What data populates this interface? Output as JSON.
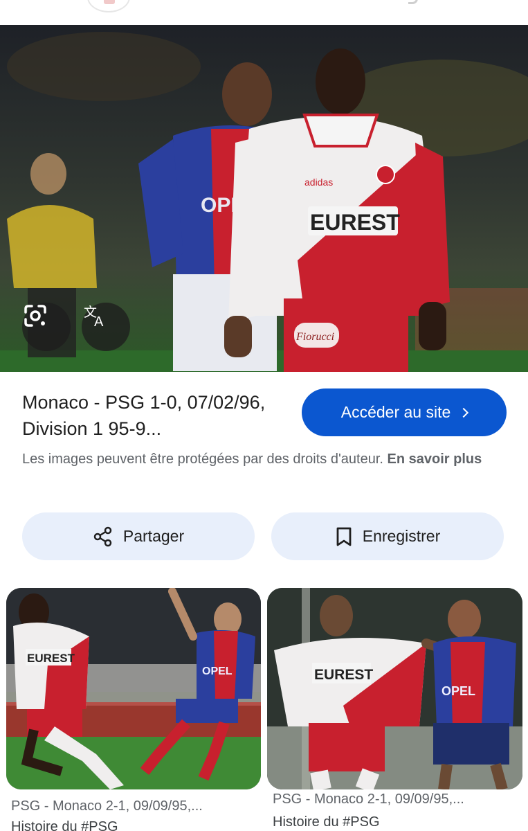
{
  "result": {
    "title": "Monaco - PSG 1-0, 07/02/96, Division 1 95-9...",
    "visit_label": "Accéder au site",
    "copyright_text": "Les images peuvent être protégées par des droits d'auteur.",
    "copyright_link": "En savoir plus",
    "share_label": "Partager",
    "save_label": "Enregistrer",
    "hero_shirt_text": "EUREST",
    "hero_brand_text": "adidas",
    "hero_shorts_text": "Fiorucci",
    "hero_opponent_text": "OPEL"
  },
  "hero_actions": {
    "lens_icon": "google-lens-icon",
    "translate_icon": "translate-icon"
  },
  "related": [
    {
      "caption": "PSG - Monaco 2-1, 09/09/95,...",
      "source": "Histoire du #PSG",
      "shirt_text": "EUREST",
      "opponent_text": "OPEL"
    },
    {
      "caption": "PSG - Monaco 2-1, 09/09/95,...",
      "source": "Histoire du #PSG",
      "shirt_text": "EUREST",
      "opponent_text": "OPEL"
    }
  ],
  "colors": {
    "primary_button": "#0b57d0",
    "tonal_button": "#e8effb",
    "monaco_red": "#c8202e",
    "psg_blue": "#2b3f9e"
  }
}
